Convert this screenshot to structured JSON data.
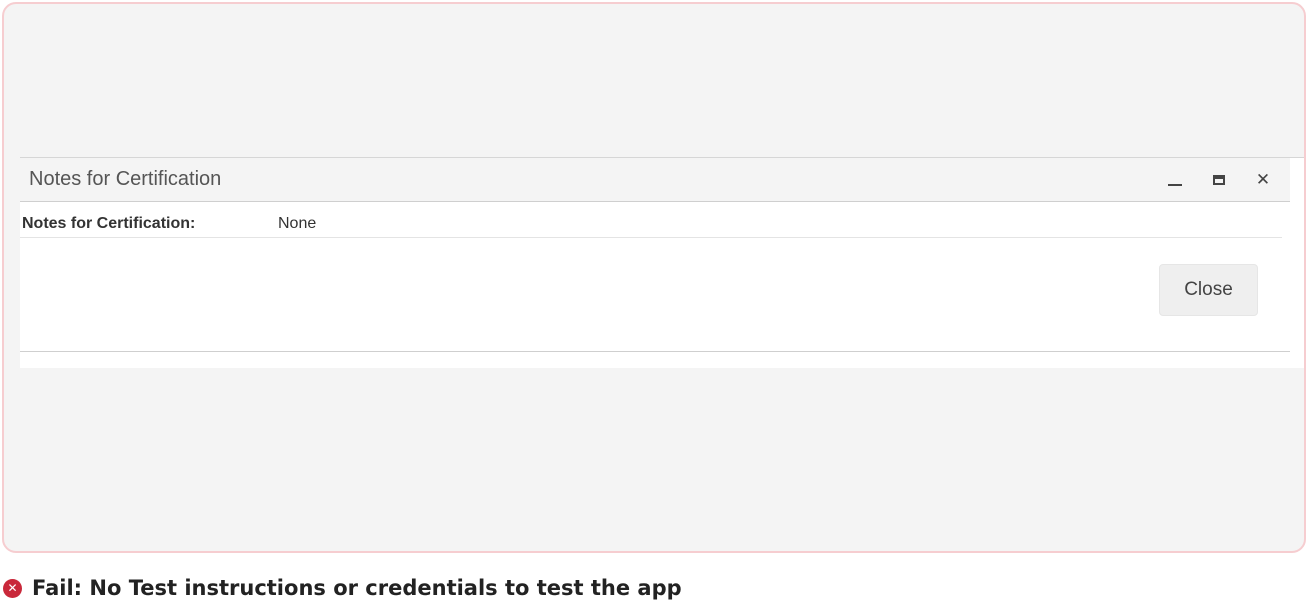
{
  "dialog": {
    "title": "Notes for Certification",
    "field_label": "Notes for Certification:",
    "field_value": "None",
    "close_label": "Close"
  },
  "window_controls": {
    "minimize_icon": "minimize-icon",
    "maximize_icon": "maximize-icon",
    "close_icon": "close-icon",
    "close_glyph": "✕"
  },
  "status": {
    "icon": "fail-icon",
    "icon_glyph": "✕",
    "text": "Fail: No Test instructions or credentials to test the app",
    "color": "#c9283a"
  }
}
